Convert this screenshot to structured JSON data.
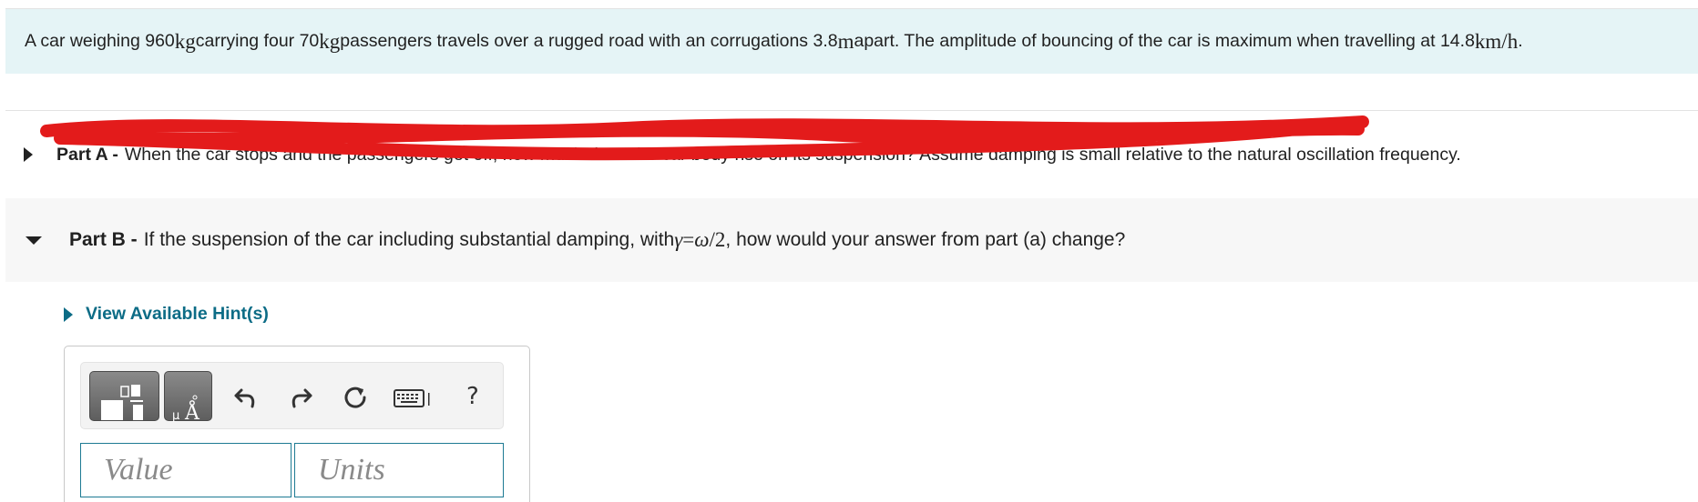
{
  "problem": {
    "t1": "A car weighing 960 ",
    "u1": "kg",
    "t2": " carrying four 70 ",
    "u2": "kg",
    "t3": " passengers travels over a rugged road with an corrugations 3.8 ",
    "u3": "m",
    "t4": " apart. The amplitude of bouncing of the car is maximum when travelling at 14.8 ",
    "u4": "km/h",
    "t5": " ."
  },
  "partA": {
    "label": "Part A -",
    "text_visible": " When the car stops and the passengers get off, how much does the car body rise on its suspension? Assume damping is small relative to the natural oscillation frequency."
  },
  "partB": {
    "label": "Part B -",
    "t1": "If the suspension of the car including substantial damping, with ",
    "gamma": "γ",
    "eq": " = ",
    "omega": "ω",
    "frac": "/2",
    "t2": ", how would your answer from part (a) change?"
  },
  "hint": {
    "label": "View Available Hint(s)"
  },
  "answer": {
    "value_placeholder": "Value",
    "units_placeholder": "Units",
    "help_label": "?"
  },
  "icons": {
    "templates": "templates-icon",
    "units": "units-icon",
    "undo": "undo-icon",
    "redo": "redo-icon",
    "reset": "reset-icon",
    "keyboard": "keyboard-icon"
  },
  "colors": {
    "problem_bg": "#e5f4f6",
    "hint_color": "#0c6c86",
    "scribble": "#e31b1b",
    "field_border": "#1d7a93"
  }
}
